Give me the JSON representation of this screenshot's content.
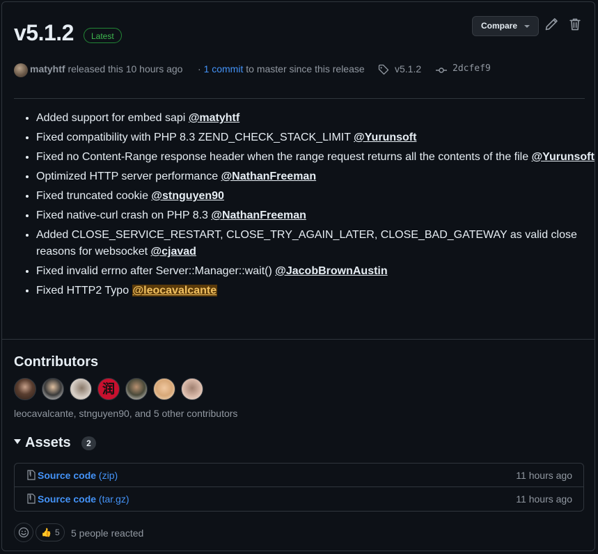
{
  "release": {
    "title": "v5.1.2",
    "badge": "Latest",
    "compare_label": "Compare",
    "author": "matyhtf",
    "released_text": "released this 10 hours ago",
    "commit_sep": "·",
    "commit_link": "1 commit",
    "commit_rest": "to master since this release",
    "tag": "v5.1.2",
    "commit_hash": "2dcfef9"
  },
  "notes": [
    {
      "text": "Added support for embed sapi ",
      "mention": "@matyhtf",
      "highlight": false
    },
    {
      "text": "Fixed compatibility with PHP 8.3 ZEND_CHECK_STACK_LIMIT ",
      "mention": "@Yurunsoft",
      "highlight": false
    },
    {
      "text": "Fixed no Content-Range response header when the range request returns all the contents of the file ",
      "mention": "@Yurunsoft",
      "highlight": false
    },
    {
      "text": "Optimized HTTP server performance ",
      "mention": "@NathanFreeman",
      "highlight": false
    },
    {
      "text": "Fixed truncated cookie ",
      "mention": "@stnguyen90",
      "highlight": false
    },
    {
      "text": "Fixed native-curl crash on PHP 8.3 ",
      "mention": "@NathanFreeman",
      "highlight": false
    },
    {
      "text": "Added CLOSE_SERVICE_RESTART, CLOSE_TRY_AGAIN_LATER, CLOSE_BAD_GATEWAY as valid close reasons for websocket ",
      "mention": "@cjavad",
      "highlight": false
    },
    {
      "text": "Fixed invalid errno after Server::Manager::wait() ",
      "mention": "@JacobBrownAustin",
      "highlight": false
    },
    {
      "text": "Fixed HTTP2 Typo ",
      "mention": "@leocavalcante",
      "highlight": true
    }
  ],
  "contributors": {
    "title": "Contributors",
    "summary": "leocavalcante, stnguyen90, and 5 other contributors"
  },
  "assets": {
    "title": "Assets",
    "count": "2",
    "items": [
      {
        "name": "Source code",
        "ext": "(zip)",
        "time": "11 hours ago"
      },
      {
        "name": "Source code",
        "ext": "(tar.gz)",
        "time": "11 hours ago"
      }
    ]
  },
  "reactions": {
    "emoji": "👍",
    "count": "5",
    "summary": "5 people reacted"
  },
  "colors": {
    "background": "#0d1117",
    "link": "#4493f8",
    "badge_green": "#3fb950",
    "muted": "#9198a1"
  }
}
